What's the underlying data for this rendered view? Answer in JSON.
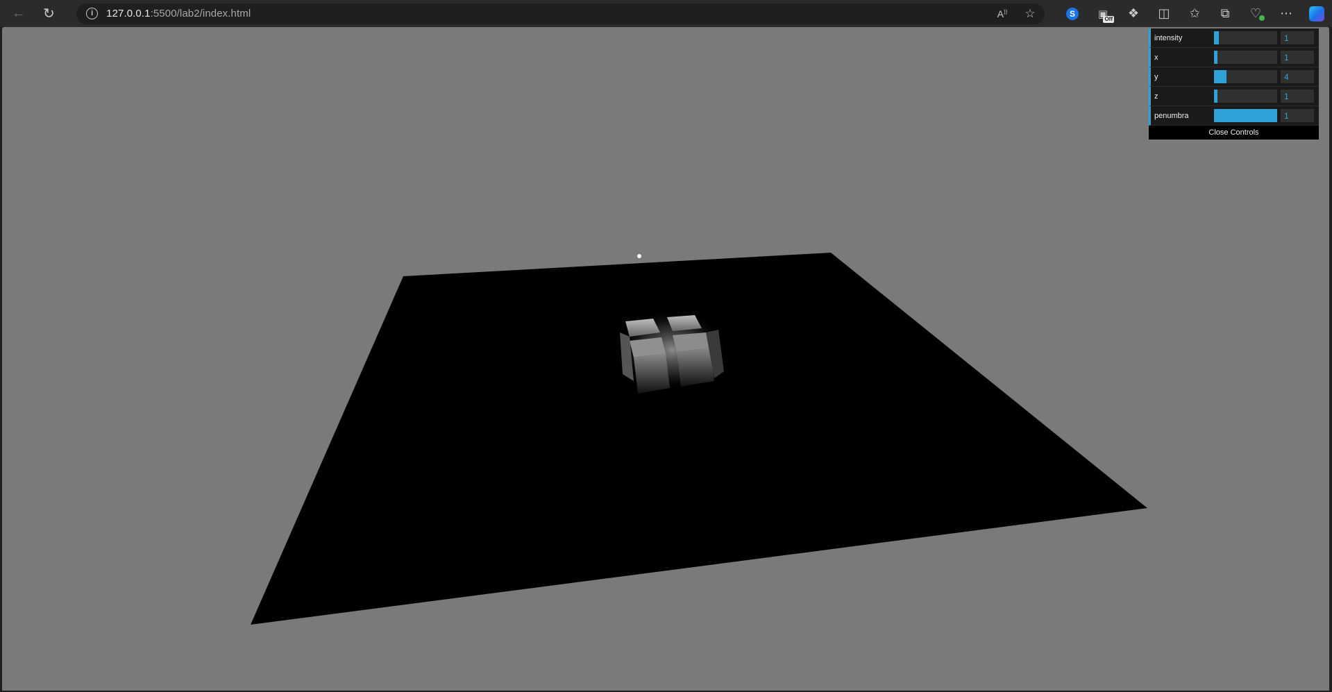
{
  "browser": {
    "url_host": "127.0.0.1",
    "url_rest": ":5500/lab2/index.html",
    "icons": {
      "back": "back-arrow-icon",
      "reload": "reload-icon",
      "site_info": "info-icon",
      "read_aloud": "read-aloud-icon",
      "favorite": "star-icon",
      "extension_shazam": "shazam-icon",
      "extension_off": "extension-off-icon",
      "extensions": "puzzle-icon",
      "split_screen": "split-screen-icon",
      "favorites": "favorites-icon",
      "collections": "collections-icon",
      "browser_essentials": "heart-pulse-icon",
      "menu": "more-icon",
      "copilot": "copilot-icon"
    },
    "off_badge": "Off"
  },
  "gui": {
    "controls": [
      {
        "label": "intensity",
        "value": "1",
        "fill": 0.08
      },
      {
        "label": "x",
        "value": "1",
        "fill": 0.05
      },
      {
        "label": "y",
        "value": "4",
        "fill": 0.2
      },
      {
        "label": "z",
        "value": "1",
        "fill": 0.05
      },
      {
        "label": "penumbra",
        "value": "1",
        "fill": 1.0
      }
    ],
    "close_label": "Close Controls"
  },
  "scene": {
    "background_color": "#7a7a7a",
    "plane_color": "#000000"
  }
}
